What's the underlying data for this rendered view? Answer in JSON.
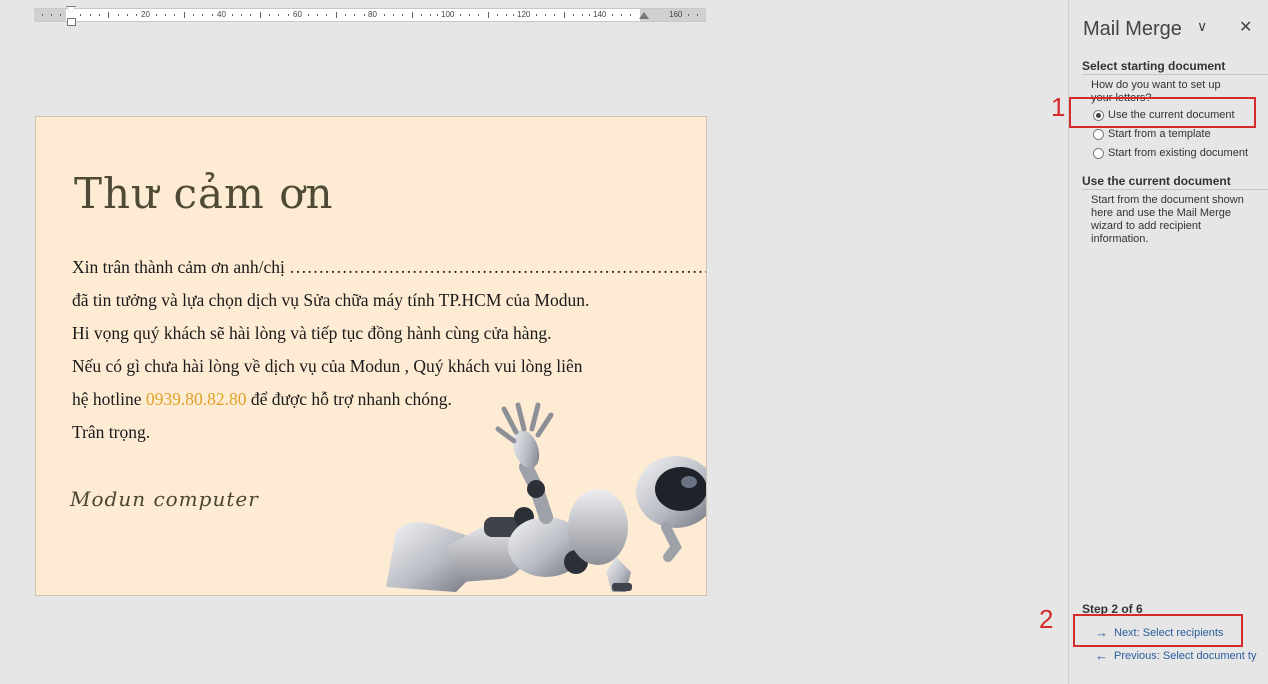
{
  "ruler": {
    "labels": [
      "20",
      "40",
      "60",
      "80",
      "100",
      "120",
      "140",
      "160"
    ]
  },
  "card": {
    "title": "Thư cảm ơn",
    "lines": [
      "Xin trân thành cảm ơn anh/chị  …………………………………………………………………",
      "đã tin tưởng và  lựa chọn dịch vụ Sửa chữa máy tính TP.HCM của Modun.",
      "Hi vọng quý khách sẽ hài lòng và tiếp tục đồng hành cùng cửa hàng.",
      "Nếu có gì chưa hài lòng về dịch vụ của Modun , Quý khách vui lòng liên"
    ],
    "hotline_prefix": "hệ hotline ",
    "hotline": "0939.80.82.80",
    "hotline_suffix": " để được hỗ trợ nhanh chóng.",
    "closing": "Trân trọng.",
    "signature": "Modun computer"
  },
  "pane": {
    "title": "Mail Merge",
    "section1": "Select starting document",
    "question": "How do you want to set up your letters?",
    "options": [
      "Use the current document",
      "Start from a template",
      "Start from existing document"
    ],
    "selected_index": 0,
    "section2": "Use the current document",
    "description": "Start from the document shown here and use the Mail Merge wizard to add recipient information.",
    "step": "Step 2 of 6",
    "next": "Next: Select recipients",
    "previous": "Previous: Select document ty"
  },
  "annotations": [
    "1",
    "2"
  ],
  "colors": {
    "accent_red": "#d52b2b",
    "link_blue": "#2a5d9c",
    "page_bg": "#fdebd3",
    "hotline": "#e0a229"
  }
}
